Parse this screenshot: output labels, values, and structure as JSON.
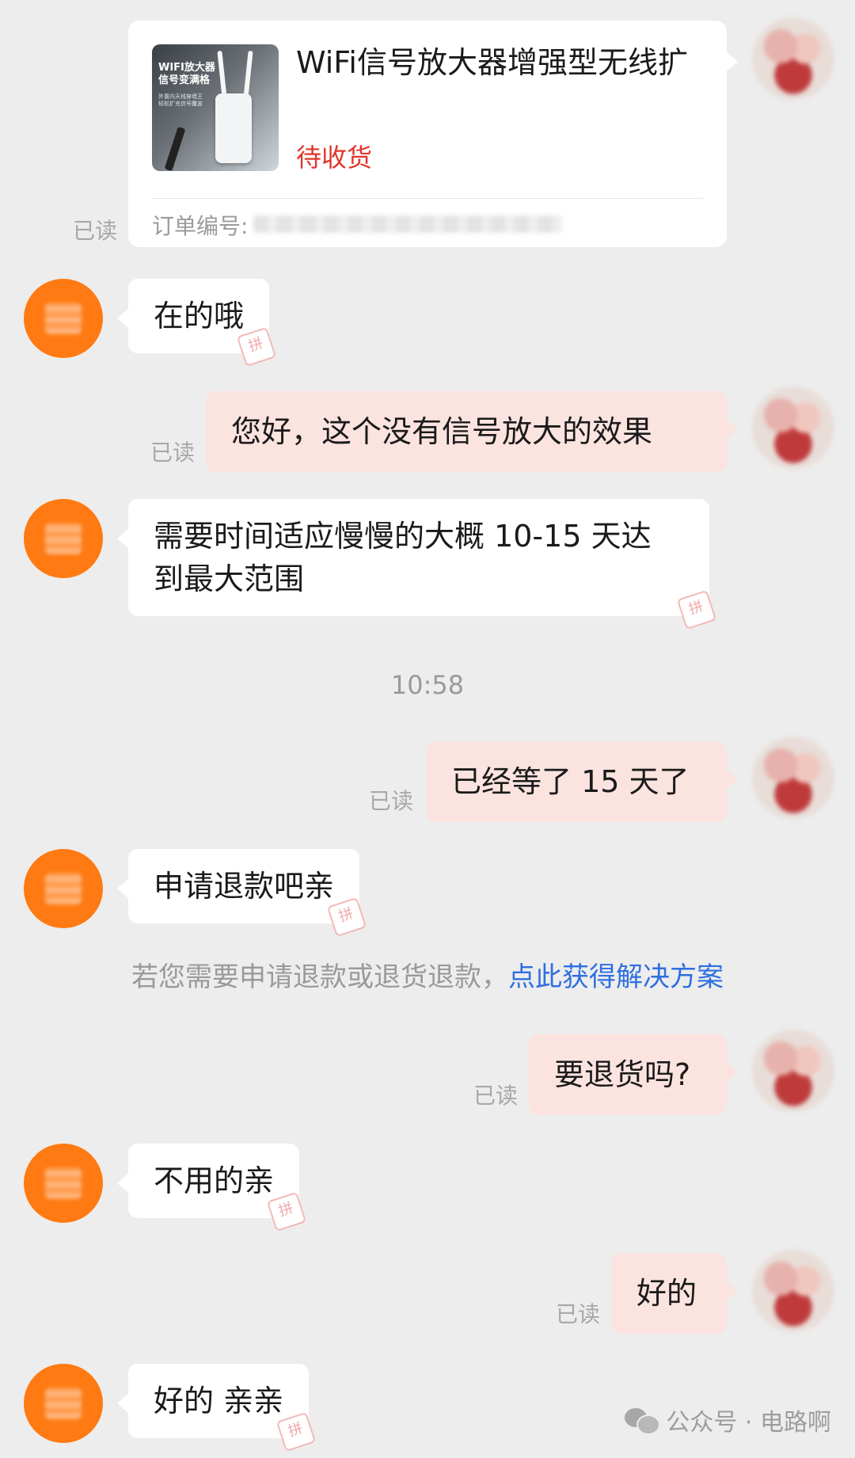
{
  "order_card": {
    "product_image_text": "WIFI放大器\n信号变满格",
    "product_image_subtext": "外置内天线穿墙王\n轻松扩充信号覆盖",
    "title": "WiFi信号放大器增强型无线扩",
    "status": "待收货",
    "order_label": "订单编号:",
    "read_label": "已读"
  },
  "messages": [
    {
      "side": "in",
      "text": "在的哦"
    },
    {
      "side": "out",
      "text": "您好，这个没有信号放大的效果",
      "read": "已读"
    },
    {
      "side": "in",
      "text": "需要时间适应慢慢的大概 10-15 天达\n到最大范围"
    },
    {
      "side": "time",
      "text": "10:58"
    },
    {
      "side": "out",
      "text": "已经等了 15 天了",
      "read": "已读"
    },
    {
      "side": "in",
      "text": "申请退款吧亲"
    },
    {
      "side": "out",
      "text": "要退货吗?",
      "read": "已读"
    },
    {
      "side": "in",
      "text": "不用的亲"
    },
    {
      "side": "out",
      "text": "好的",
      "read": "已读"
    },
    {
      "side": "in",
      "text": "好的 亲亲"
    }
  ],
  "notice": {
    "text": "若您需要申请退款或退货退款，",
    "link": "点此获得解决方案"
  },
  "stamp_glyph": "拼",
  "watermark": {
    "text": "公众号 · 电路啊"
  },
  "colors": {
    "background": "#ededed",
    "outgoing_bubble": "#fbe3e0",
    "incoming_bubble": "#ffffff",
    "status_red": "#e0352b",
    "link_blue": "#2f6fe0",
    "merchant_avatar": "#ff7a12"
  }
}
